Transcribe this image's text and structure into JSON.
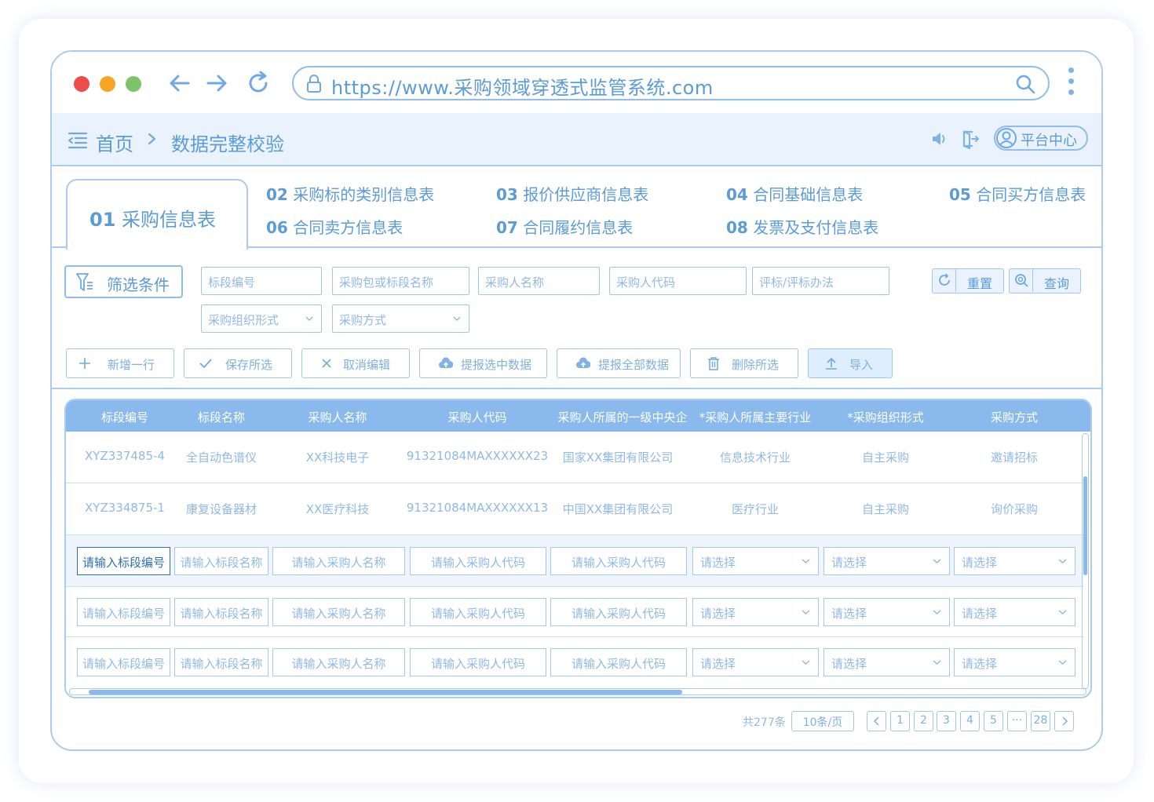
{
  "browser": {
    "url": "https://www.采购领域穿透式监管系统.com"
  },
  "breadcrumb": {
    "home": "首页",
    "current": "数据完整校验"
  },
  "header": {
    "platform_label": "平台中心"
  },
  "tabs": {
    "active": {
      "num": "01",
      "label": "采购信息表"
    },
    "others": [
      {
        "num": "02",
        "label": "采购标的类别信息表"
      },
      {
        "num": "03",
        "label": "报价供应商信息表"
      },
      {
        "num": "04",
        "label": "合同基础信息表"
      },
      {
        "num": "05",
        "label": "合同买方信息表"
      },
      {
        "num": "06",
        "label": "合同卖方信息表"
      },
      {
        "num": "07",
        "label": "合同履约信息表"
      },
      {
        "num": "08",
        "label": "发票及支付信息表"
      }
    ]
  },
  "filter": {
    "button_label": "筛选条件",
    "fields": [
      {
        "placeholder": "标段编号"
      },
      {
        "placeholder": "采购包或标段名称"
      },
      {
        "placeholder": "采购人名称"
      },
      {
        "placeholder": "采购人代码"
      },
      {
        "placeholder": "评标/评标办法"
      },
      {
        "placeholder": "采购组织形式"
      },
      {
        "placeholder": "采购方式"
      }
    ],
    "reset_label": "重置",
    "query_label": "查询"
  },
  "actions": [
    {
      "label": "新增一行",
      "icon": "plus-icon"
    },
    {
      "label": "保存所选",
      "icon": "check-icon"
    },
    {
      "label": "取消编辑",
      "icon": "close-icon"
    },
    {
      "label": "提报选中数据",
      "icon": "cloud-upload-icon"
    },
    {
      "label": "提报全部数据",
      "icon": "cloud-upload-icon"
    },
    {
      "label": "删除所选",
      "icon": "trash-icon"
    },
    {
      "label": "导入",
      "icon": "upload-icon"
    }
  ],
  "table": {
    "columns": [
      "标段编号",
      "标段名称",
      "采购人名称",
      "采购人代码",
      "采购人所属的一级中央企",
      "*采购人所属主要行业",
      "*采购组织形式",
      "采购方式"
    ],
    "rows": [
      [
        "XYZ337485-4",
        "全自动色谱仪",
        "XX科技电子",
        "91321084MAXXXXXX23",
        "国家XX集团有限公司",
        "信息技术行业",
        "自主采购",
        "邀请招标"
      ],
      [
        "XYZ334875-1",
        "康复设备器材",
        "XX医疗科技",
        "91321084MAXXXXXX13",
        "中国XX集团有限公司",
        "医疗行业",
        "自主采购",
        "询价采购"
      ]
    ],
    "input_placeholders": [
      "请输入标段编号",
      "请输入标段名称",
      "请输入采购人名称",
      "请输入采购人代码",
      "请输入采购人代码",
      "请选择",
      "请选择",
      "请选择"
    ]
  },
  "pagination": {
    "total": "共277条",
    "page_size": "10条/页",
    "pages": [
      "1",
      "2",
      "3",
      "4",
      "5",
      "···",
      "28"
    ]
  },
  "colors": {
    "accent": "#5b9bd8",
    "border": "#a9ccf0",
    "header_bg": "#8ab9ee",
    "bar_bg": "#eaf3fd",
    "dot_red": "#ee4b4b",
    "dot_yellow": "#f7a623",
    "dot_green": "#7cc36a"
  }
}
